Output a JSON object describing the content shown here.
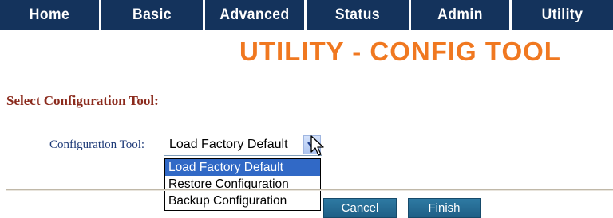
{
  "nav": {
    "tabs": [
      {
        "label": "Home"
      },
      {
        "label": "Basic"
      },
      {
        "label": "Advanced"
      },
      {
        "label": "Status"
      },
      {
        "label": "Admin"
      },
      {
        "label": "Utility"
      }
    ]
  },
  "page_title": "UTILITY - CONFIG TOOL",
  "section_heading": "Select Configuration Tool:",
  "config_tool": {
    "label": "Configuration Tool:",
    "selected": "Load Factory Default",
    "options": [
      "Load Factory Default",
      "Restore Configuration",
      "Backup Configuration"
    ]
  },
  "buttons": {
    "cancel": "Cancel",
    "finish": "Finish"
  },
  "colors": {
    "nav_bg": "#14335c",
    "title": "#f07820",
    "heading": "#8b2a1c",
    "button": "#2e7aa3",
    "selection": "#3169c6"
  }
}
